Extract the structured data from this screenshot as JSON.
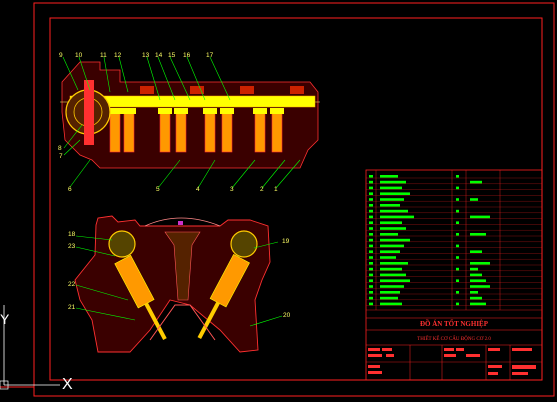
{
  "drawing": {
    "top_view": {
      "labels": [
        "9",
        "10",
        "11",
        "12",
        "13",
        "14",
        "15",
        "16",
        "17",
        "8",
        "7",
        "6",
        "5",
        "4",
        "3",
        "2",
        "1"
      ]
    },
    "section_view": {
      "labels": [
        "18",
        "23",
        "19",
        "22",
        "21",
        "20"
      ]
    }
  },
  "title_block": {
    "project": "ĐỒ ÁN TỐT NGHIỆP",
    "drawing_title": "THIẾT KẾ CƠ CẤU ĐỘNG CƠ 2.0"
  },
  "axis_icons": {
    "y_label": "Y",
    "x_mark": "X"
  },
  "colors": {
    "background": "#000000",
    "frame": "#ff2020",
    "text": "#ffff66",
    "accent": "#00ff00"
  }
}
